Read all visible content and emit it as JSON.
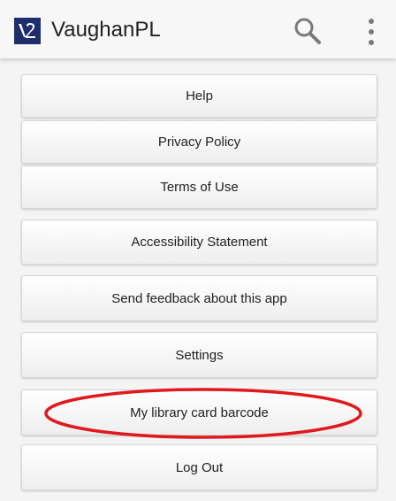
{
  "app": {
    "title": "VaughanPL",
    "brand_color": "#1e2d6b",
    "logo_icon": "vaughanpl-logo-icon"
  },
  "toolbar": {
    "search_icon": "search-icon",
    "more_icon": "more-vertical-icon"
  },
  "menu": {
    "items": [
      {
        "label": "Help"
      },
      {
        "label": "Privacy Policy"
      },
      {
        "label": "Terms of Use"
      },
      {
        "label": "Accessibility Statement"
      },
      {
        "label": "Send feedback about this app"
      },
      {
        "label": "Settings"
      },
      {
        "label": "My library card barcode",
        "highlighted": true
      },
      {
        "label": "Log Out"
      }
    ]
  },
  "annotation": {
    "color": "#e0191d",
    "shape": "ellipse",
    "target": "My library card barcode"
  }
}
